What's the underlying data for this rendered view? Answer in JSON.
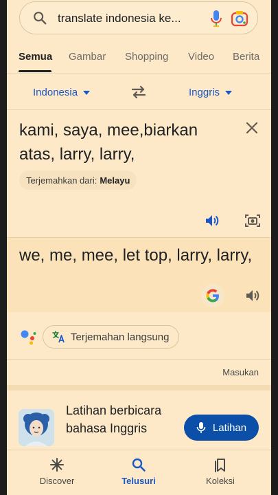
{
  "search": {
    "query": "translate indonesia ke..."
  },
  "tabs": [
    {
      "label": "Semua",
      "active": true
    },
    {
      "label": "Gambar"
    },
    {
      "label": "Shopping"
    },
    {
      "label": "Video"
    },
    {
      "label": "Berita"
    }
  ],
  "translator": {
    "source_lang": "Indonesia",
    "target_lang": "Inggris",
    "source_text": "kami, saya, mee,biarkan atas, larry, larry,",
    "detected_prefix": "Terjemahkan dari:",
    "detected_lang": "Melayu",
    "output_text": "we, me, mee, let top, larry, larry,"
  },
  "live": {
    "label": "Terjemahan langsung"
  },
  "feedback": {
    "label": "Masukan"
  },
  "practice": {
    "title": "Latihan berbicara bahasa Inggris",
    "button_label": "Latihan"
  },
  "bottom_nav": [
    {
      "label": "Discover",
      "icon": "asterisk-icon"
    },
    {
      "label": "Telusuri",
      "icon": "search-icon",
      "active": true
    },
    {
      "label": "Koleksi",
      "icon": "bookmarks-icon"
    }
  ],
  "colors": {
    "background": "#fde9c7",
    "accent_blue": "#1a57c6",
    "button_blue": "#0b4fa8"
  }
}
